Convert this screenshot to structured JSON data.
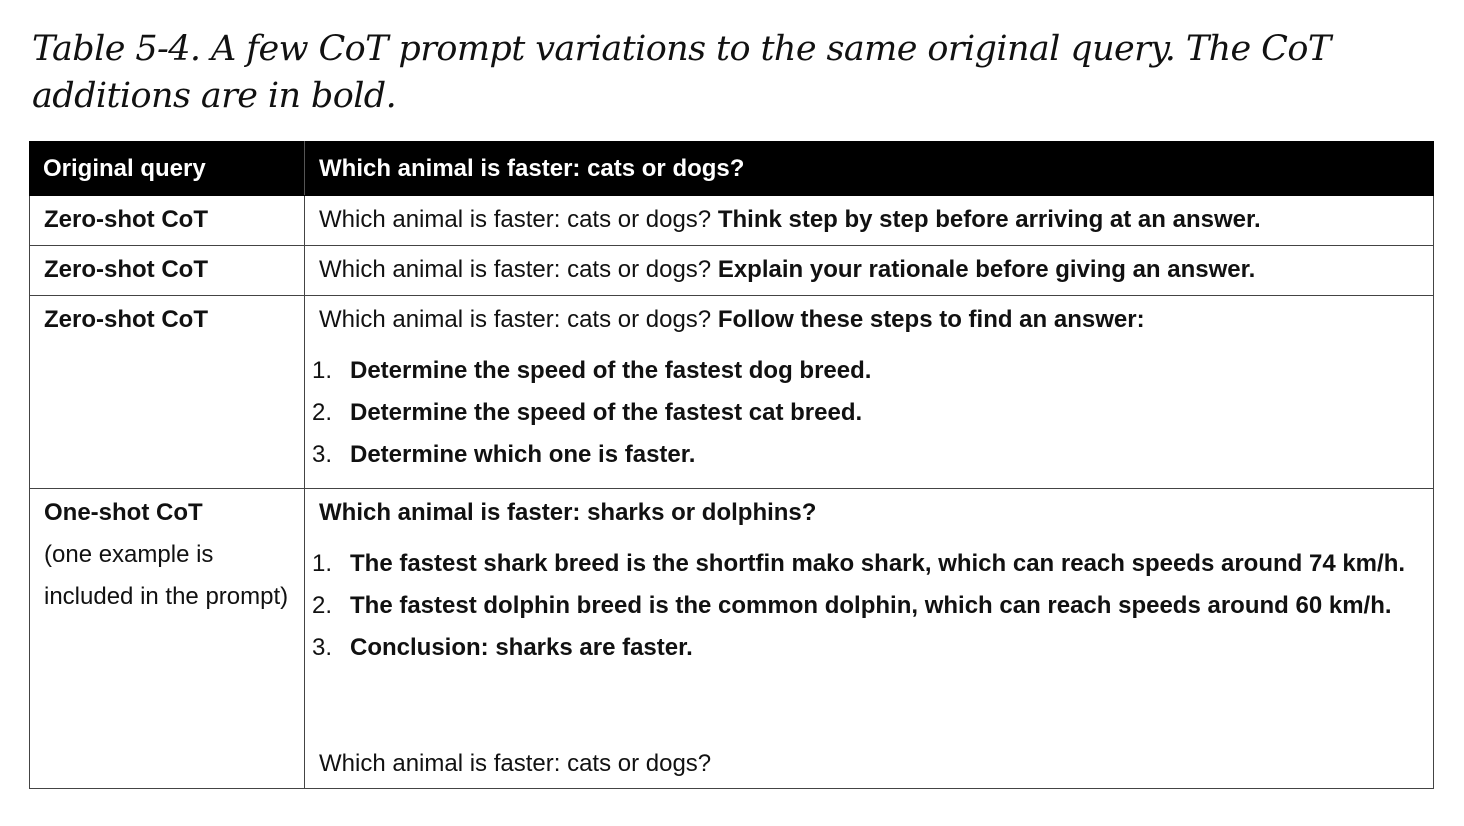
{
  "caption": "Table 5-4. A few CoT prompt variations to the same original query. The CoT additions are in bold.",
  "header": {
    "label": "Original query",
    "query": "Which animal is faster: cats or dogs?"
  },
  "rows": [
    {
      "label": "Zero-shot CoT",
      "plain": "Which animal is faster: cats or dogs? ",
      "bold": "Think step by step before arriving at an answer."
    },
    {
      "label": "Zero-shot CoT",
      "plain": "Which animal is faster: cats or dogs? ",
      "bold": "Explain your rationale before giving an answer."
    },
    {
      "label": "Zero-shot CoT",
      "plain": "Which animal is faster: cats or dogs? ",
      "bold": "Follow these steps to find an answer:",
      "steps": [
        {
          "num": "1.",
          "text": "Determine the speed of the fastest dog breed."
        },
        {
          "num": "2.",
          "text": "Determine the speed of the fastest cat breed."
        },
        {
          "num": "3.",
          "text": "Determine which one is faster."
        }
      ]
    },
    {
      "label": "One-shot CoT",
      "sublabel": "(one example is included in the prompt)",
      "example_question": "Which animal is faster: sharks or dolphins?",
      "steps": [
        {
          "num": "1.",
          "text": "The fastest shark breed is the shortfin mako shark, which can reach speeds around 74 km/h."
        },
        {
          "num": "2.",
          "text": "The fastest dolphin breed is the common dolphin, which can reach speeds around 60 km/h."
        },
        {
          "num": "3.",
          "text": "Conclusion: sharks are faster."
        }
      ],
      "final_query": "Which animal is faster: cats or dogs?"
    }
  ]
}
